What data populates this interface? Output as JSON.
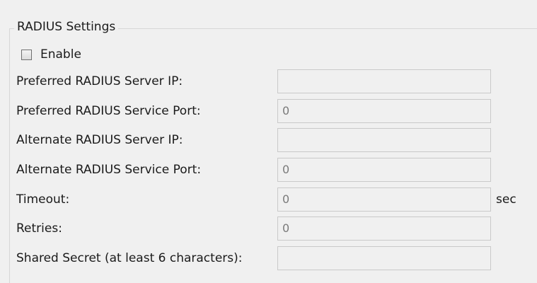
{
  "group": {
    "title": "RADIUS Settings",
    "enable_label": "Enable",
    "enable_checked": false
  },
  "fields": [
    {
      "label": "Preferred RADIUS Server IP:",
      "value": ""
    },
    {
      "label": "Preferred RADIUS Service Port:",
      "value": "0"
    },
    {
      "label": "Alternate RADIUS Server IP:",
      "value": ""
    },
    {
      "label": "Alternate RADIUS Service Port:",
      "value": "0"
    },
    {
      "label": "Timeout:",
      "value": "0",
      "unit": "sec"
    },
    {
      "label": "Retries:",
      "value": "0"
    },
    {
      "label": "Shared Secret (at least 6 characters):",
      "value": ""
    }
  ]
}
